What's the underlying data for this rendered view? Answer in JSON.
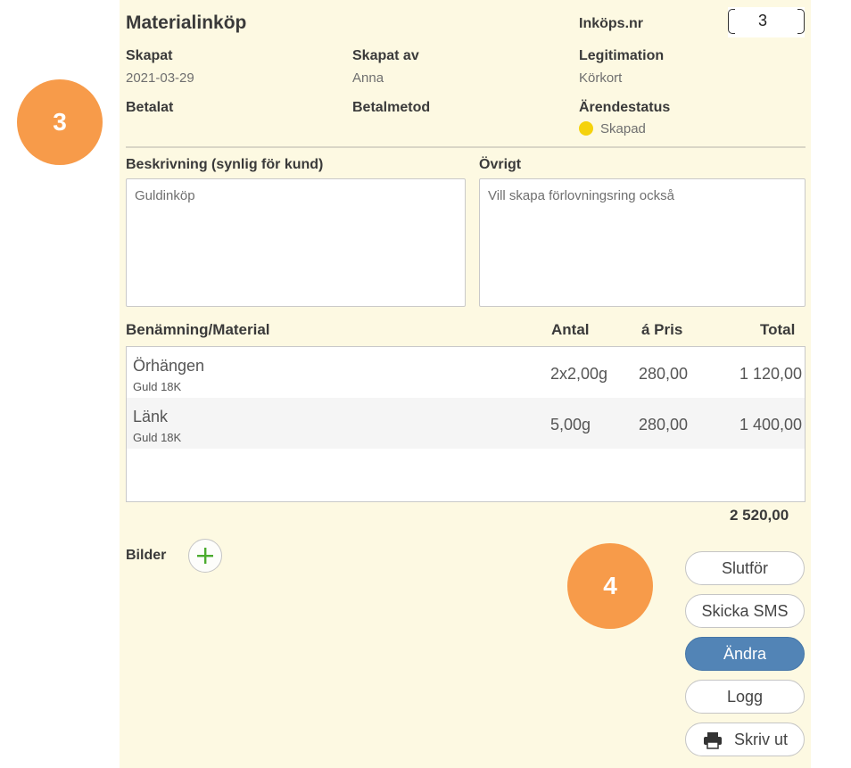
{
  "header": {
    "title": "Materialinköp",
    "purchase_nr_label": "Inköps.nr",
    "purchase_nr_value": "3"
  },
  "info": {
    "created_label": "Skapat",
    "created_value": "2021-03-29",
    "created_by_label": "Skapat av",
    "created_by_value": "Anna",
    "id_label": "Legitimation",
    "id_value": "Körkort",
    "paid_label": "Betalat",
    "payment_method_label": "Betalmetod",
    "status_label": "Ärendestatus",
    "status_value": "Skapad",
    "status_color": "#f5d20c"
  },
  "description": {
    "label": "Beskrivning (synlig för kund)",
    "value": "Guldinköp"
  },
  "other": {
    "label": "Övrigt",
    "value": "Vill skapa förlovningsring också"
  },
  "table": {
    "headers": {
      "name": "Benämning/Material",
      "qty": "Antal",
      "price": "á Pris",
      "total": "Total"
    },
    "rows": [
      {
        "name": "Örhängen",
        "material": "Guld 18K",
        "qty": "2x2,00g",
        "price": "280,00",
        "total": "1 120,00"
      },
      {
        "name": "Länk",
        "material": "Guld 18K",
        "qty": "5,00g",
        "price": "280,00",
        "total": "1 400,00"
      }
    ],
    "grand_total": "2 520,00"
  },
  "images": {
    "label": "Bilder",
    "add_icon": "plus-icon"
  },
  "actions": {
    "finish": "Slutför",
    "send_sms": "Skicka SMS",
    "edit": "Ändra",
    "log": "Logg",
    "print": "Skriv ut",
    "print_icon": "printer-icon"
  },
  "badges": {
    "left": "3",
    "right": "4"
  },
  "colors": {
    "panel_bg": "#fdf9e2",
    "accent": "#5284b6",
    "badge": "#f79b4a",
    "add_icon": "#4bab2e"
  }
}
